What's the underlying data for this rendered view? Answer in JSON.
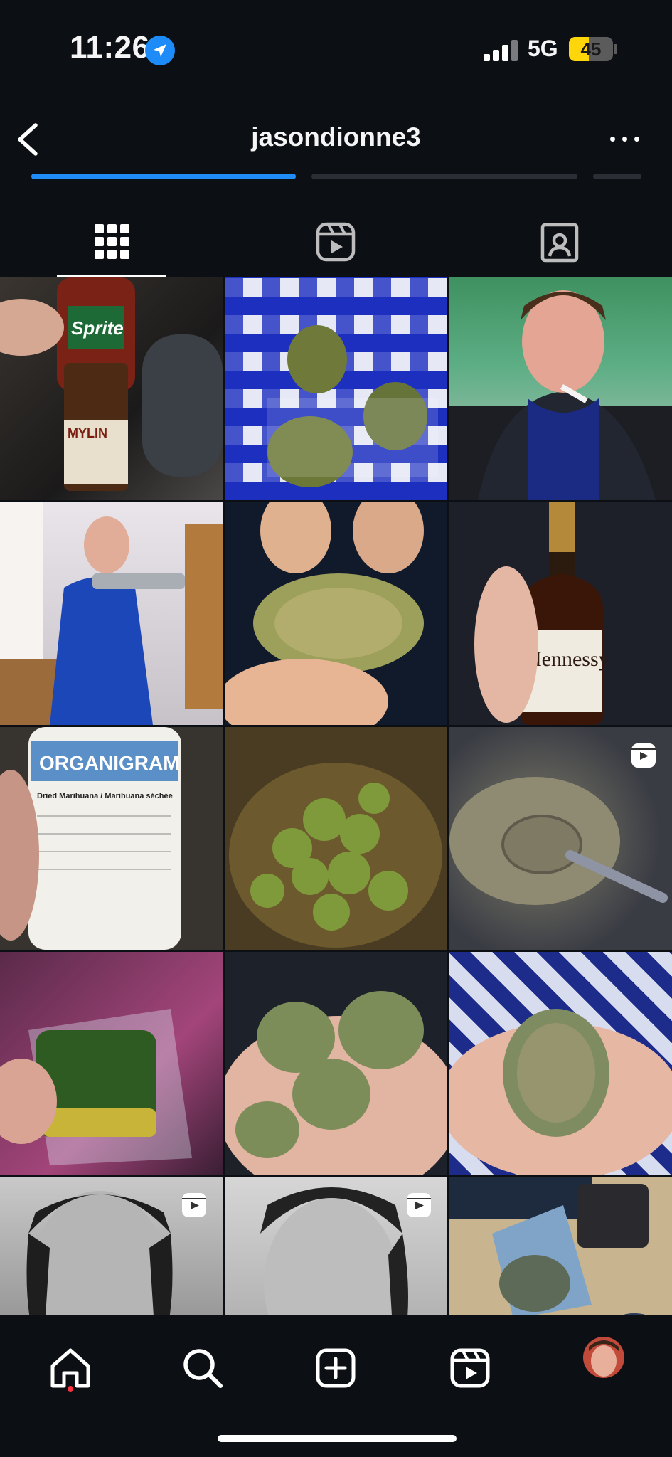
{
  "status_bar": {
    "time": "11:26",
    "network": "5G",
    "battery": "45",
    "battery_level": 0.45,
    "location_icon": "location-arrow-icon"
  },
  "header": {
    "username": "jasondionne3",
    "back_icon": "chevron-left-icon",
    "more_icon": "more-horizontal-icon"
  },
  "tabs": [
    {
      "name": "posts",
      "icon": "grid-icon",
      "active": true
    },
    {
      "name": "reels",
      "icon": "reels-icon",
      "active": false
    },
    {
      "name": "tagged",
      "icon": "tagged-person-icon",
      "active": false
    }
  ],
  "grid": {
    "tiles": [
      {
        "subject": "soda bottle and syrup bottle",
        "text": "Sprite",
        "text2": "MYLIN",
        "reel": false
      },
      {
        "subject": "bags on blue checkered cloth",
        "reel": false
      },
      {
        "subject": "selfie with cigarette, green wall",
        "reel": false
      },
      {
        "subject": "person in blue jacket holding device",
        "reel": false
      },
      {
        "subject": "green bud close-up held in fingers",
        "reel": false
      },
      {
        "subject": "bottle held in hand",
        "text": "Hennessy",
        "reel": false
      },
      {
        "subject": "white container with label",
        "text": "ORGANIGRAM",
        "text2": "Dried Marihuana / Marihuana séchée",
        "reel": false
      },
      {
        "subject": "green buds pile",
        "reel": false
      },
      {
        "subject": "spoon in powder",
        "reel": true
      },
      {
        "subject": "green block in plastic",
        "reel": false
      },
      {
        "subject": "buds in palm",
        "reel": false
      },
      {
        "subject": "single bud in palm",
        "reel": false
      },
      {
        "subject": "black and white portrait smoking",
        "reel": true
      },
      {
        "subject": "black and white portrait smoking 2",
        "reel": true
      },
      {
        "subject": "bag on desk with keyboard",
        "reel": false
      }
    ]
  },
  "bottom_nav": [
    {
      "name": "home",
      "icon": "home-icon"
    },
    {
      "name": "search",
      "icon": "search-icon"
    },
    {
      "name": "create",
      "icon": "plus-square-icon"
    },
    {
      "name": "reels",
      "icon": "reels-icon"
    },
    {
      "name": "profile",
      "icon": "profile-avatar"
    }
  ],
  "colors": {
    "background": "#0c1014",
    "accent_blue": "#1d8cf8",
    "notification_red": "#ff3040",
    "battery_yellow": "#ffd60a"
  }
}
